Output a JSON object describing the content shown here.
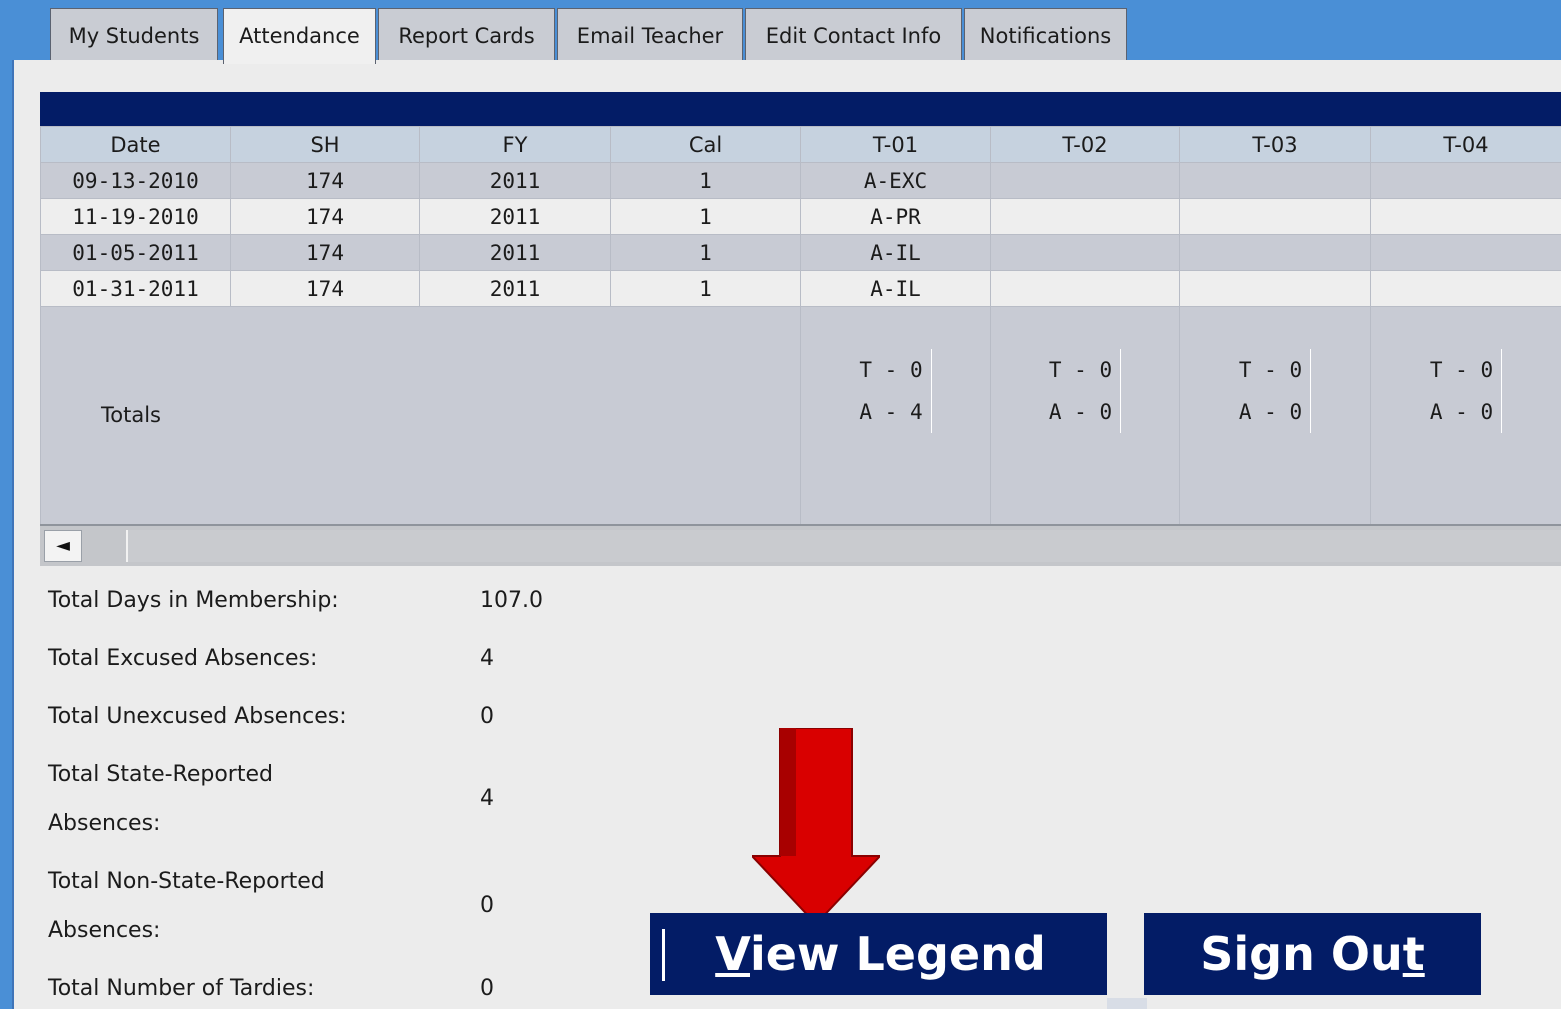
{
  "tabs": [
    {
      "label": "My Students"
    },
    {
      "label": "Attendance"
    },
    {
      "label": "Report Cards"
    },
    {
      "label": "Email Teacher"
    },
    {
      "label": "Edit Contact Info"
    },
    {
      "label": "Notifications"
    }
  ],
  "active_tab": "Attendance",
  "table": {
    "headers": [
      "Date",
      "SH",
      "FY",
      "Cal",
      "T-01",
      "T-02",
      "T-03",
      "T-04"
    ],
    "rows": [
      [
        "09-13-2010",
        "174",
        "2011",
        "1",
        "A-EXC",
        "",
        "",
        ""
      ],
      [
        "11-19-2010",
        "174",
        "2011",
        "1",
        "A-PR",
        "",
        "",
        ""
      ],
      [
        "01-05-2011",
        "174",
        "2011",
        "1",
        "A-IL",
        "",
        "",
        ""
      ],
      [
        "01-31-2011",
        "174",
        "2011",
        "1",
        "A-IL",
        "",
        "",
        ""
      ]
    ],
    "totals_label": "Totals",
    "totals": [
      {
        "t": "T - 0",
        "a": "A - 4"
      },
      {
        "t": "T - 0",
        "a": "A - 0"
      },
      {
        "t": "T - 0",
        "a": "A - 0"
      },
      {
        "t": "T - 0",
        "a": "A - 0"
      }
    ]
  },
  "scrollbar": {
    "left_arrow": "◄"
  },
  "stats": [
    {
      "label": "Total Days in Membership:",
      "value": "107.0"
    },
    {
      "label": "Total Excused Absences:",
      "value": "4"
    },
    {
      "label": "Total Unexcused Absences:",
      "value": "0"
    },
    {
      "label_line1": "Total State-Reported",
      "label_line2": "Absences:",
      "value": "4"
    },
    {
      "label_line1": "Total Non-State-Reported",
      "label_line2": "Absences:",
      "value": "0"
    },
    {
      "label": "Total Number of Tardies:",
      "value": "0"
    }
  ],
  "buttons": {
    "view_legend": {
      "first": "V",
      "rest": "iew Legend"
    },
    "sign_out": {
      "main": "Sign Ou",
      "last": "t"
    }
  },
  "colors": {
    "header_blue": "#4a8fd6",
    "navy": "#031c66",
    "code_green": "#2d6a1f",
    "arrow_red": "#d90000"
  }
}
